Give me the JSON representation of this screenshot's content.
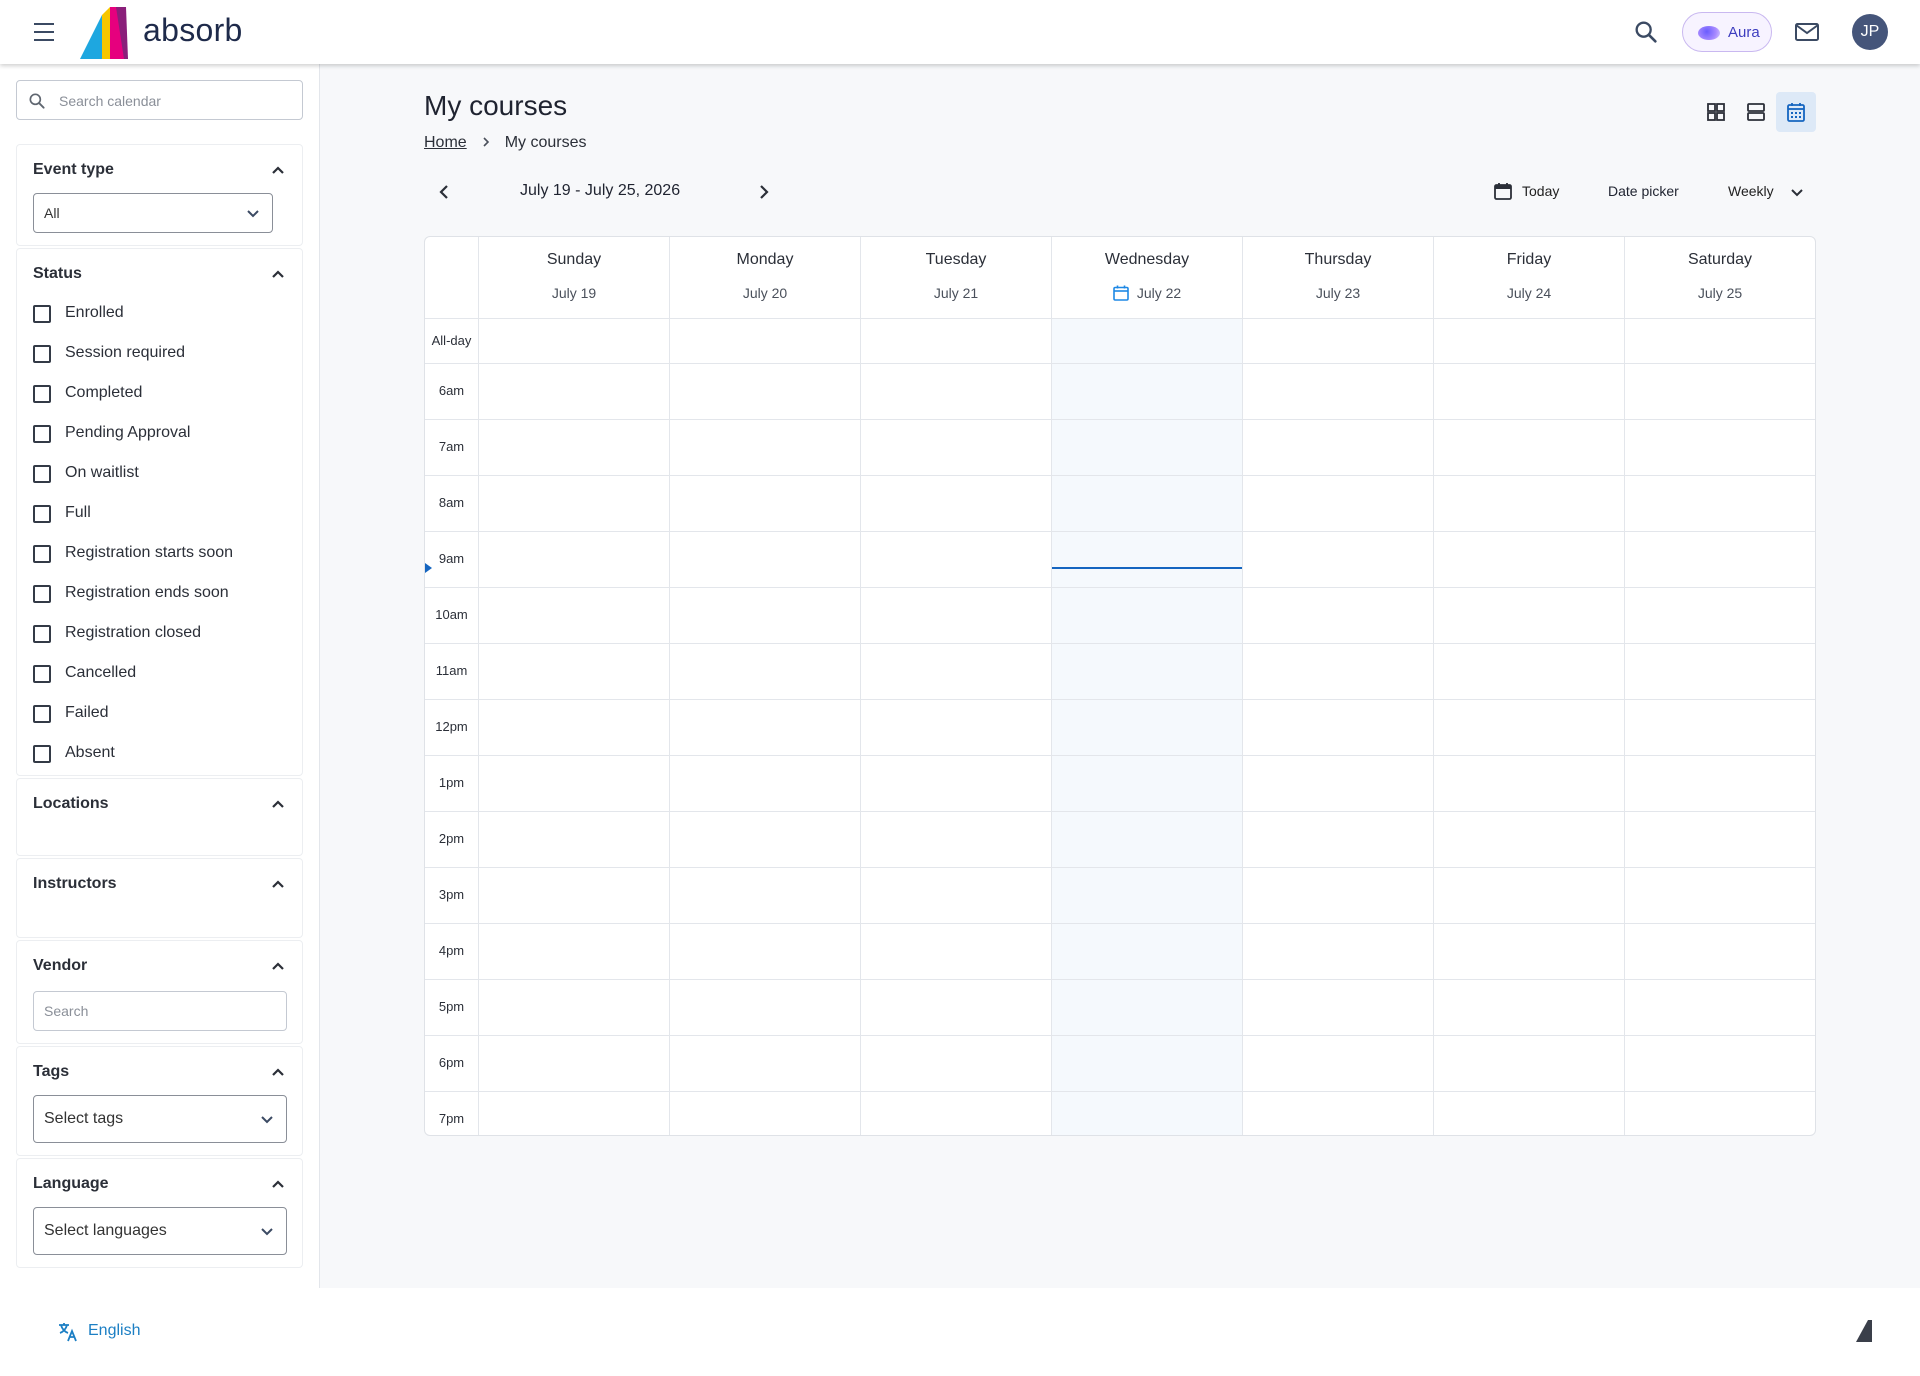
{
  "header": {
    "brand": "absorb",
    "aura_label": "Aura",
    "avatar_initials": "JP",
    "accent_color": "#3d3dbf"
  },
  "sidebar": {
    "search_placeholder": "Search calendar",
    "event_type": {
      "title": "Event type",
      "value": "All"
    },
    "status": {
      "title": "Status",
      "items": [
        "Enrolled",
        "Session required",
        "Completed",
        "Pending Approval",
        "On waitlist",
        "Full",
        "Registration starts soon",
        "Registration ends soon",
        "Registration closed",
        "Cancelled",
        "Failed",
        "Absent"
      ]
    },
    "locations": {
      "title": "Locations"
    },
    "instructors": {
      "title": "Instructors"
    },
    "vendor": {
      "title": "Vendor",
      "placeholder": "Search"
    },
    "tags": {
      "title": "Tags",
      "value": "Select tags"
    },
    "language": {
      "title": "Language",
      "value": "Select languages"
    }
  },
  "main": {
    "title": "My courses",
    "breadcrumb": {
      "home": "Home",
      "current": "My courses"
    },
    "range": "July 19 - July 25, 2026",
    "today_label": "Today",
    "date_picker_label": "Date picker",
    "view_label": "Weekly",
    "active_view": "calendar"
  },
  "calendar": {
    "days": [
      {
        "name": "Sunday",
        "date": "July 19"
      },
      {
        "name": "Monday",
        "date": "July 20"
      },
      {
        "name": "Tuesday",
        "date": "July 21"
      },
      {
        "name": "Wednesday",
        "date": "July 22",
        "today": true
      },
      {
        "name": "Thursday",
        "date": "July 23"
      },
      {
        "name": "Friday",
        "date": "July 24"
      },
      {
        "name": "Saturday",
        "date": "July 25"
      }
    ],
    "all_day_label": "All-day",
    "hours": [
      "6am",
      "7am",
      "8am",
      "9am",
      "10am",
      "11am",
      "12pm",
      "1pm",
      "2pm",
      "3pm",
      "4pm",
      "5pm",
      "6pm",
      "7pm"
    ],
    "today_highlight_color": "#f5f9fd",
    "now_line_color": "#1565c0"
  },
  "footer": {
    "language": "English"
  }
}
